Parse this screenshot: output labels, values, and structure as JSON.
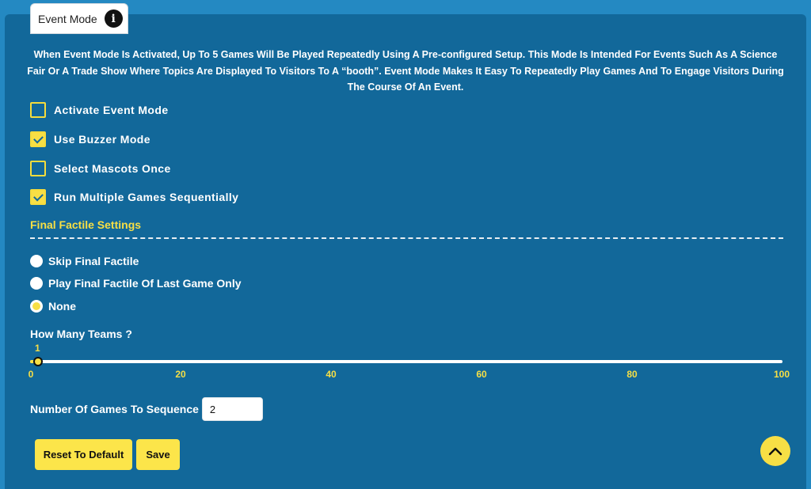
{
  "tab": {
    "label": "Event Mode",
    "info_icon_glyph": "i"
  },
  "description": "When Event Mode Is Activated, Up To 5 Games Will Be Played Repeatedly Using A Pre-configured Setup. This Mode Is Intended For Events Such As A Science Fair Or A Trade Show Where Topics Are Displayed To Visitors To A “booth”. Event Mode Makes It Easy To Repeatedly Play Games And To Engage Visitors During The Course Of An Event.",
  "options": [
    {
      "label": "Activate Event Mode",
      "checked": false
    },
    {
      "label": "Use Buzzer Mode",
      "checked": true
    },
    {
      "label": "Select Mascots Once",
      "checked": false
    },
    {
      "label": "Run Multiple Games Sequentially",
      "checked": true
    }
  ],
  "final_factile": {
    "title": "Final Factile Settings",
    "choices": [
      {
        "label": "Skip Final Factile",
        "selected": false
      },
      {
        "label": "Play Final Factile Of Last Game Only",
        "selected": false
      },
      {
        "label": "None",
        "selected": true
      }
    ]
  },
  "teams": {
    "label": "How Many Teams ?",
    "value": "1",
    "min": 0,
    "max": 100,
    "ticks": [
      "0",
      "20",
      "40",
      "60",
      "80",
      "100"
    ]
  },
  "games": {
    "label": "Number Of Games To Sequence",
    "value": "2"
  },
  "buttons": {
    "reset": "Reset To Default",
    "save": "Save"
  },
  "colors": {
    "accent": "#f7df45",
    "panel": "#12689a",
    "background": "#2489c2"
  }
}
